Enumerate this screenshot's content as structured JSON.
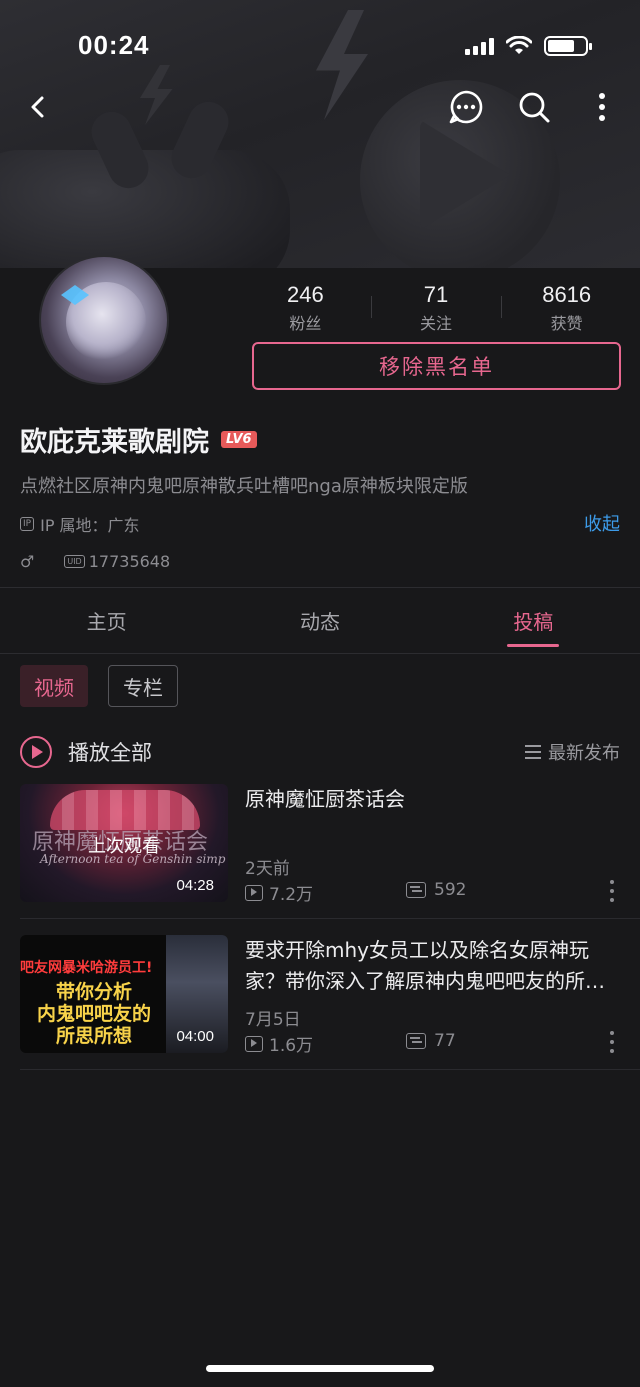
{
  "status_bar": {
    "time": "00:24"
  },
  "header": {
    "back_icon": "chevron-left-icon",
    "message_icon": "chat-bubble-icon",
    "search_icon": "search-icon",
    "more_icon": "more-vertical-icon"
  },
  "profile": {
    "stats": [
      {
        "value": "246",
        "label": "粉丝"
      },
      {
        "value": "71",
        "label": "关注"
      },
      {
        "value": "8616",
        "label": "获赞"
      }
    ],
    "action_button": "移除黑名单",
    "username": "欧庇克莱歌剧院",
    "level_badge": "LV6",
    "signature": "点燃社区原神内鬼吧原神散兵吐槽吧nga原神板块限定版",
    "ip_icon_text": "IP",
    "ip_location": "IP 属地：广东",
    "collapse_label": "收起",
    "gender_symbol": "♂",
    "uid_icon_text": "UID",
    "uid": "17735648"
  },
  "tabs": [
    {
      "label": "主页",
      "active": false
    },
    {
      "label": "动态",
      "active": false
    },
    {
      "label": "投稿",
      "active": true
    }
  ],
  "filter_chips": [
    {
      "label": "视频",
      "active": true
    },
    {
      "label": "专栏",
      "active": false
    }
  ],
  "list_header": {
    "play_all": "播放全部",
    "sort": "最新发布"
  },
  "videos": [
    {
      "title": "原神魔怔厨茶话会",
      "thumb_title": "原神魔怔厨茶话会",
      "thumb_subtitle": "Afternoon tea of Genshin simp",
      "last_watched": "上次观看",
      "duration": "04:28",
      "date": "2天前",
      "views": "7.2万",
      "danmaku": "592"
    },
    {
      "title": "要求开除mhy女员工以及除名女原神玩家？带你深入了解原神内鬼吧吧友的所思所想",
      "thumb_top": "吧友网暴米哈游员工!",
      "thumb_main": "带你分析\n内鬼吧吧友的\n所思所想",
      "duration": "04:00",
      "date": "7月5日",
      "views": "1.6万",
      "danmaku": "77"
    }
  ],
  "colors": {
    "accent": "#e7678f",
    "link": "#3d9be9",
    "background": "#18181a"
  }
}
